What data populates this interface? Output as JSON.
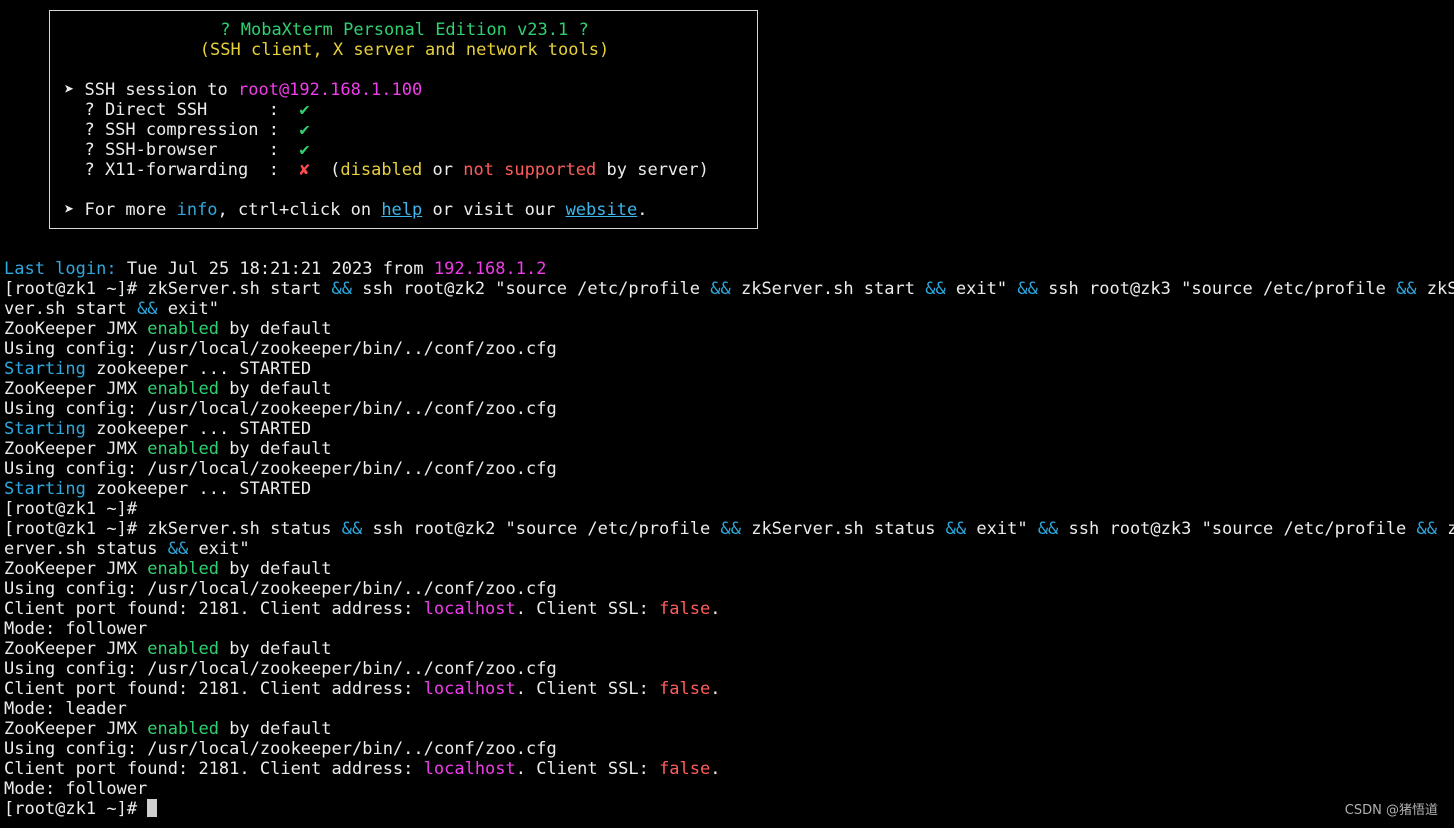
{
  "banner": {
    "title": "? MobaXterm Personal Edition v23.1 ?",
    "subtitle": "(SSH client, X server and network tools)",
    "session_prefix": "➤ SSH session to ",
    "session_target": "root@192.168.1.100",
    "features": [
      {
        "label": "  ? Direct SSH      :  ",
        "status": "✔"
      },
      {
        "label": "  ? SSH compression :  ",
        "status": "✔"
      },
      {
        "label": "  ? SSH-browser     :  ",
        "status": "✔"
      },
      {
        "label": "  ? X11-forwarding  :  ",
        "status": "✘"
      }
    ],
    "x11_note": {
      "open": "  (",
      "disabled": "disabled",
      "or": " or ",
      "not_supported": "not supported",
      "close": " by server)"
    },
    "more": {
      "prefix": "➤ For more ",
      "info": "info",
      "mid": ", ctrl+click on ",
      "help": "help",
      "mid2": " or visit our ",
      "website": "website",
      "end": "."
    }
  },
  "session": {
    "last_login_label": "Last login:",
    "last_login_text": " Tue Jul 25 18:21:21 2023 from ",
    "last_login_ip": "192.168.1.2",
    "prompt": "[root@zk1 ~]# ",
    "amp": "&&",
    "cmd1": {
      "p1": "zkServer.sh start ",
      "p2": " ssh root@zk2 \"source /etc/profile ",
      "p3": " zkServer.sh start ",
      "p4": " exit\" ",
      "p5": " ssh root@zk3 \"source /etc/profile ",
      "p6": " zkSer",
      "wrap1": "ver.sh start ",
      "wrap2": " exit\""
    },
    "cmd2": {
      "p1": "zkServer.sh status ",
      "p2": " ssh root@zk2 \"source /etc/profile ",
      "p3": " zkServer.sh status ",
      "p4": " exit\" ",
      "p5": " ssh root@zk3 \"source /etc/profile ",
      "p6": " zkS",
      "wrap1": "erver.sh status ",
      "wrap2": " exit\""
    },
    "jmx_prefix": "ZooKeeper JMX ",
    "jmx_enabled": "enabled",
    "jmx_suffix": " by default",
    "using_config": "Using config: /usr/local/zookeeper/bin/../conf/zoo.cfg",
    "starting": "Starting",
    "starting_rest": " zookeeper ... STARTED",
    "client_prefix": "Client port found: 2181. Client address: ",
    "client_host": "localhost",
    "client_mid": ". Client SSL: ",
    "client_ssl": "false",
    "client_end": ".",
    "modes": [
      "Mode: follower",
      "Mode: leader",
      "Mode: follower"
    ]
  },
  "watermark": "CSDN @猪悟道",
  "colors": {
    "background": "#000000",
    "text": "#ececec",
    "green": "#2fd171",
    "gold": "#e7d13a",
    "magenta": "#ef3de9",
    "red": "#ff5c5c",
    "cyan": "#2ea8df"
  }
}
